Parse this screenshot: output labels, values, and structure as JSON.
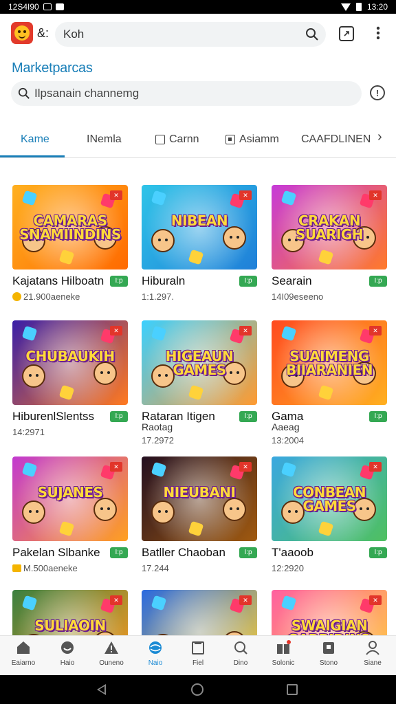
{
  "status_bar": {
    "time_left": "12S4I90",
    "time_right": "13:20"
  },
  "topbar": {
    "short_label": "&:",
    "search_value": "Koh"
  },
  "section_title": "Marketparcas",
  "search": {
    "value": "Ilpsanain channemg"
  },
  "tabs": [
    {
      "label": "Kame",
      "active": true
    },
    {
      "label": "INemla"
    },
    {
      "label": "Carnn"
    },
    {
      "label": "Asiamm"
    },
    {
      "label": "CAAFDLINEN"
    }
  ],
  "cards": [
    {
      "title": "Kajatans Hilboatn",
      "tag": "I:p",
      "meta": "21.900aeneke",
      "meta_icon": "coin",
      "thumb_text": "CAMARAS SNAMIINDINS",
      "colors": [
        "#ffb020",
        "#ff6a00"
      ]
    },
    {
      "title": "Hiburaln",
      "tag": "I:p",
      "meta": "1:1.297.",
      "thumb_text": "NIBEAN",
      "colors": [
        "#2fc4e8",
        "#1f7fd8"
      ]
    },
    {
      "title": "Searain",
      "tag": "I:p",
      "meta": "14I09eseeno",
      "thumb_text": "CRAKAN SUARIGH",
      "colors": [
        "#c63ad8",
        "#ff7a2a"
      ]
    },
    {
      "title": "HiburenlSlentss",
      "tag": "I:p",
      "meta": "14:2971",
      "thumb_text": "CHUBAUKIH",
      "colors": [
        "#3a1fa8",
        "#ff7a20"
      ]
    },
    {
      "title": "Rataran Itigen",
      "title2": "Raotag",
      "tag": "I:p",
      "meta": "17.2972",
      "thumb_text": "HIGEAUN GAMES",
      "colors": [
        "#3ad0ff",
        "#ff9a30"
      ]
    },
    {
      "title": "Gama",
      "title2": "Aaeag",
      "tag": "I:p",
      "meta": "13:2004",
      "thumb_text": "SUAIMENG BIIARANIEN",
      "colors": [
        "#ff4a20",
        "#ffb020"
      ]
    },
    {
      "title": "Pakelan Slbanke",
      "tag": "I:p",
      "meta": "M.500aeneke",
      "meta_icon": "square",
      "thumb_text": "SUJANES",
      "colors": [
        "#c23ad0",
        "#ffa020"
      ]
    },
    {
      "title": "Batller Chaoban",
      "tag": "I:p",
      "meta": "17.244",
      "thumb_text": "NIEUBANI",
      "colors": [
        "#241020",
        "#a05a10"
      ]
    },
    {
      "title": "T'aaoob",
      "tag": "I:p",
      "meta": "12:2920",
      "thumb_text": "CONBEAN GAMES",
      "colors": [
        "#3aa8e0",
        "#4fc060"
      ]
    },
    {
      "title": "",
      "tag": "",
      "meta": "",
      "thumb_text": "SULIAOIN",
      "colors": [
        "#3a8040",
        "#ff9a20"
      ]
    },
    {
      "title": "",
      "tag": "",
      "meta": "",
      "thumb_text": "",
      "colors": [
        "#2a6ae0",
        "#ffd030"
      ]
    },
    {
      "title": "",
      "tag": "",
      "meta": "",
      "thumb_text": "SWAIGIAN SARBIDINS",
      "colors": [
        "#ff5fa0",
        "#ffd040"
      ]
    }
  ],
  "bottom_nav": [
    {
      "label": "Eaiarno",
      "icon": "home-icon"
    },
    {
      "label": "Haio",
      "icon": "smile-icon"
    },
    {
      "label": "Ouneno",
      "icon": "warning-icon"
    },
    {
      "label": "Naio",
      "icon": "globe-icon",
      "active": true
    },
    {
      "label": "Fiel",
      "icon": "folder-icon"
    },
    {
      "label": "Dino",
      "icon": "search-icon"
    },
    {
      "label": "Solonic",
      "icon": "gift-icon"
    },
    {
      "label": "Stono",
      "icon": "store-icon"
    },
    {
      "label": "Siane",
      "icon": "person-icon"
    }
  ],
  "colors": {
    "accent": "#1a7fb8",
    "tag_green": "#34a853",
    "badge_red": "#e2352a"
  }
}
